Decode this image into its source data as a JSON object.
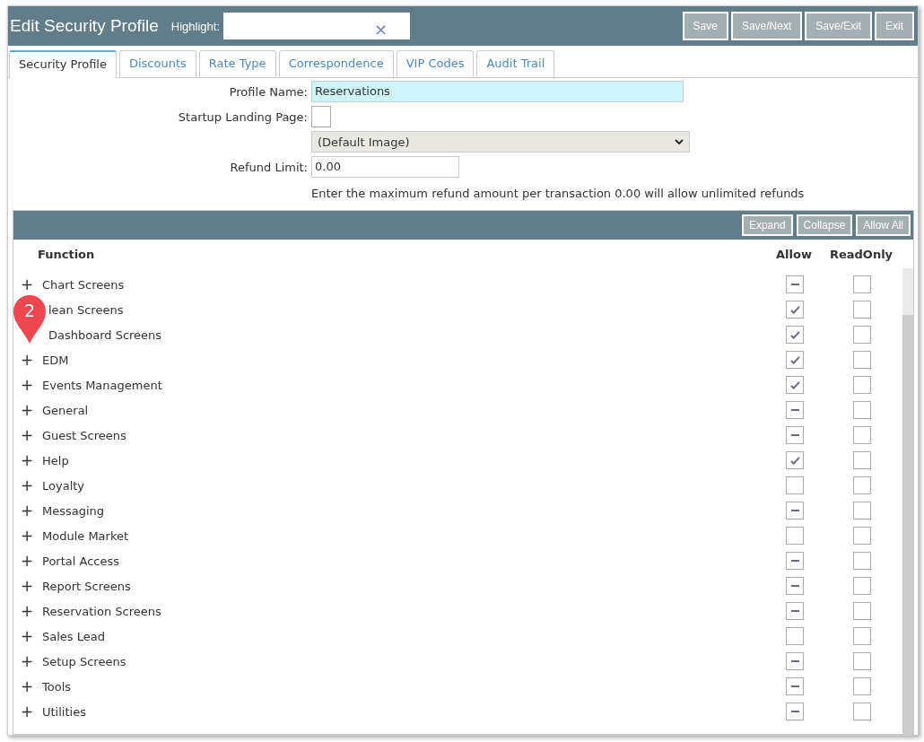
{
  "window": {
    "title": "Edit Security Profile"
  },
  "highlight": {
    "label": "Highlight:",
    "clear": "×"
  },
  "header_buttons": [
    "Save",
    "Save/Next",
    "Save/Exit",
    "Exit"
  ],
  "tabs": [
    {
      "label": "Security Profile",
      "selected": true
    },
    {
      "label": "Discounts",
      "selected": false
    },
    {
      "label": "Rate Type",
      "selected": false
    },
    {
      "label": "Correspondence",
      "selected": false
    },
    {
      "label": "VIP Codes",
      "selected": false
    },
    {
      "label": "Audit Trail",
      "selected": false
    }
  ],
  "form": {
    "profile_name_label": "Profile Name:",
    "profile_name": "Reservations",
    "landing_label": "Startup Landing Page:",
    "landing_checked": false,
    "image_select": "(Default Image)",
    "refund_label": "Refund Limit:",
    "refund_value": "0.00",
    "refund_hint": "Enter the maximum refund amount per transaction 0.00 will allow unlimited refunds"
  },
  "grid_buttons": [
    "Expand",
    "Collapse",
    "Allow All"
  ],
  "columns": [
    "Function",
    "Allow",
    "ReadOnly"
  ],
  "rows": [
    {
      "toggle": "+",
      "name": "Chart Screens",
      "checked": false,
      "indeterminate": true,
      "readonly": false
    },
    {
      "name": "lean Screens",
      "checked": true,
      "indeterminate": false,
      "readonly": false
    },
    {
      "name": "Dashboard Screens",
      "checked": true,
      "indeterminate": false,
      "readonly": false
    },
    {
      "toggle": "+",
      "name": "EDM",
      "checked": true,
      "indeterminate": false,
      "readonly": false
    },
    {
      "toggle": "+",
      "name": "Events Management",
      "checked": true,
      "indeterminate": false,
      "readonly": false
    },
    {
      "toggle": "+",
      "name": "General",
      "checked": false,
      "indeterminate": true,
      "readonly": false
    },
    {
      "toggle": "+",
      "name": "Guest Screens",
      "checked": false,
      "indeterminate": true,
      "readonly": false
    },
    {
      "toggle": "+",
      "name": "Help",
      "checked": true,
      "indeterminate": false,
      "readonly": false
    },
    {
      "toggle": "+",
      "name": "Loyalty",
      "checked": false,
      "indeterminate": false,
      "readonly": false
    },
    {
      "toggle": "+",
      "name": "Messaging",
      "checked": false,
      "indeterminate": true,
      "readonly": false
    },
    {
      "toggle": "+",
      "name": "Module Market",
      "checked": false,
      "indeterminate": false,
      "readonly": false
    },
    {
      "toggle": "+",
      "name": "Portal Access",
      "checked": false,
      "indeterminate": true,
      "readonly": false
    },
    {
      "toggle": "+",
      "name": "Report Screens",
      "checked": false,
      "indeterminate": true,
      "readonly": false
    },
    {
      "toggle": "+",
      "name": "Reservation Screens",
      "checked": false,
      "indeterminate": true,
      "readonly": false
    },
    {
      "toggle": "+",
      "name": "Sales Lead",
      "checked": false,
      "indeterminate": false,
      "readonly": false
    },
    {
      "toggle": "+",
      "name": "Setup Screens",
      "checked": false,
      "indeterminate": true,
      "readonly": false
    },
    {
      "toggle": "+",
      "name": "Tools",
      "checked": false,
      "indeterminate": true,
      "readonly": false
    },
    {
      "toggle": "+",
      "name": "Utilities",
      "checked": false,
      "indeterminate": true,
      "readonly": false
    }
  ],
  "callout": {
    "number": "2"
  }
}
